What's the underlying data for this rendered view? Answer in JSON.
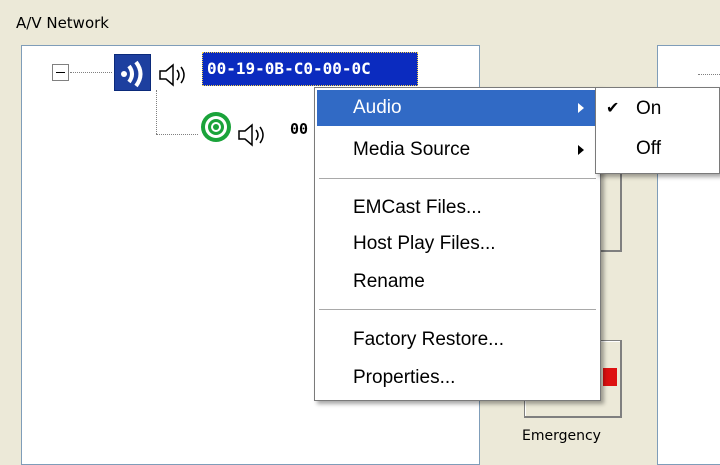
{
  "group_title": "A/V Network",
  "tree": {
    "expander": "collapse",
    "selected_device": "00-19-0B-C0-00-0C",
    "child_device_partial": "00",
    "icons": {
      "device": "audio-broadcast-icon",
      "speaker": "speaker-icon",
      "target": "target-icon"
    }
  },
  "background": {
    "emergency_label": "Emergency"
  },
  "context_menu": {
    "items": [
      {
        "label": "Audio",
        "submenu": true,
        "highlighted": true
      },
      {
        "label": "Media Source",
        "submenu": true,
        "highlighted": false
      },
      {
        "label": "EMCast Files...",
        "submenu": false,
        "highlighted": false
      },
      {
        "label": "Host Play Files...",
        "submenu": false,
        "highlighted": false
      },
      {
        "label": "Rename",
        "submenu": false,
        "highlighted": false
      },
      {
        "label": "Factory Restore...",
        "submenu": false,
        "highlighted": false
      },
      {
        "label": "Properties...",
        "submenu": false,
        "highlighted": false
      }
    ]
  },
  "audio_submenu": {
    "items": [
      {
        "label": "On",
        "checked": true
      },
      {
        "label": "Off",
        "checked": false
      }
    ]
  },
  "colors": {
    "highlight": "#316ac5",
    "selection": "#0b2bbf",
    "target_green": "#1aa33a"
  }
}
